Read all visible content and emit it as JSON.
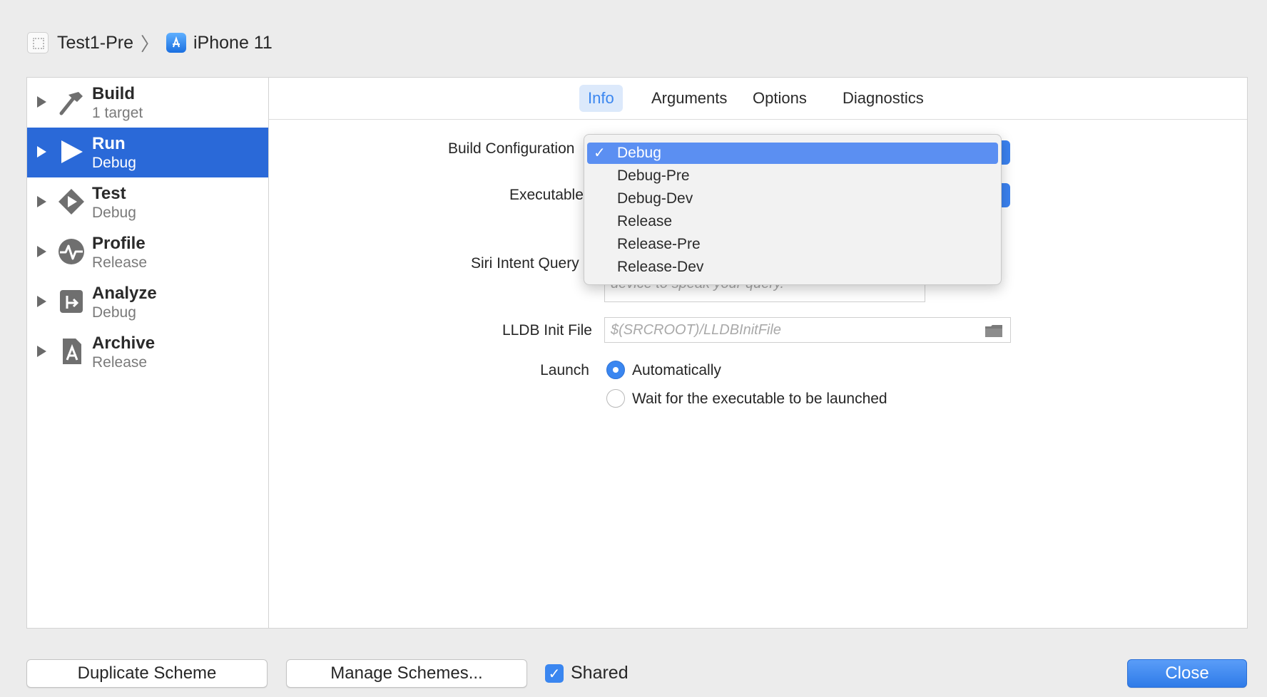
{
  "breadcrumb": {
    "project": "Test1-Pre",
    "device": "iPhone 11"
  },
  "sidebar": {
    "items": [
      {
        "title": "Build",
        "subtitle": "1 target"
      },
      {
        "title": "Run",
        "subtitle": "Debug"
      },
      {
        "title": "Test",
        "subtitle": "Debug"
      },
      {
        "title": "Profile",
        "subtitle": "Release"
      },
      {
        "title": "Analyze",
        "subtitle": "Debug"
      },
      {
        "title": "Archive",
        "subtitle": "Release"
      }
    ]
  },
  "tabs": [
    "Info",
    "Arguments",
    "Options",
    "Diagnostics"
  ],
  "active_tab": "Info",
  "form": {
    "build_configuration_label": "Build Configuration",
    "executable_label": "Executable",
    "siri_label": "Siri Intent Query",
    "siri_placeholder_fragment": "device to speak your query.",
    "lldb_label": "LLDB Init File",
    "lldb_placeholder": "$(SRCROOT)/LLDBInitFile",
    "launch_label": "Launch",
    "launch_options": [
      "Automatically",
      "Wait for the executable to be launched"
    ]
  },
  "dropdown": {
    "check": "✓",
    "options": [
      "Debug",
      "Debug-Pre",
      "Debug-Dev",
      "Release",
      "Release-Pre",
      "Release-Dev"
    ],
    "selected": "Debug"
  },
  "footer": {
    "duplicate": "Duplicate Scheme",
    "manage": "Manage Schemes...",
    "shared": "Shared",
    "close": "Close"
  },
  "colors": {
    "accent": "#2a69d8",
    "selection": "#5b8ff2"
  }
}
